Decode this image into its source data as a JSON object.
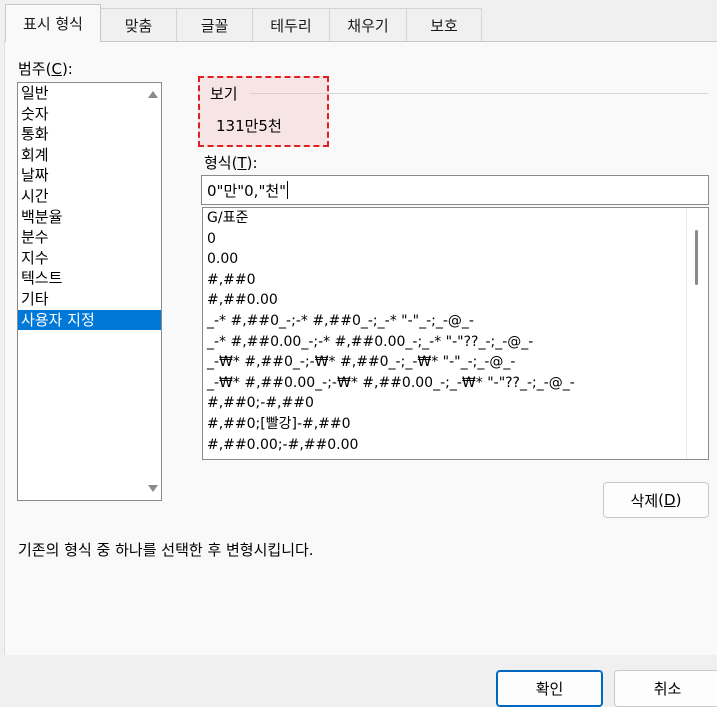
{
  "tabs": [
    {
      "label": "표시 형식",
      "active": true
    },
    {
      "label": "맞춤",
      "active": false
    },
    {
      "label": "글꼴",
      "active": false
    },
    {
      "label": "테두리",
      "active": false
    },
    {
      "label": "채우기",
      "active": false
    },
    {
      "label": "보호",
      "active": false
    }
  ],
  "category": {
    "label": "범주",
    "accel": "C",
    "items": [
      "일반",
      "숫자",
      "통화",
      "회계",
      "날짜",
      "시간",
      "백분율",
      "분수",
      "지수",
      "텍스트",
      "기타",
      "사용자 지정"
    ],
    "selected": "사용자 지정"
  },
  "sample": {
    "title": "보기",
    "value": "131만5천"
  },
  "format": {
    "label": "형식",
    "accel": "T",
    "input_value": "0\"만\"0,\"천\"",
    "items": [
      "G/표준",
      "0",
      "0.00",
      "#,##0",
      "#,##0.00",
      "_-* #,##0_-;-* #,##0_-;_-* \"-\"_-;_-@_-",
      "_-* #,##0.00_-;-* #,##0.00_-;_-* \"-\"??_-;_-@_-",
      "_-₩* #,##0_-;-₩* #,##0_-;_-₩* \"-\"_-;_-@_-",
      "_-₩* #,##0.00_-;-₩* #,##0.00_-;_-₩* \"-\"??_-;_-@_-",
      "#,##0;-#,##0",
      "#,##0;[빨강]-#,##0",
      "#,##0.00;-#,##0.00"
    ]
  },
  "delete_button": {
    "label": "삭제",
    "accel": "D"
  },
  "hint_text": "기존의 형식 중 하나를 선택한 후 변형시킵니다.",
  "ok_button": {
    "label": "확인"
  },
  "cancel_button": {
    "label": "취소"
  },
  "colors": {
    "selection": "#0078d7",
    "highlight_border": "#e02020",
    "primary_border": "#0067c0"
  }
}
